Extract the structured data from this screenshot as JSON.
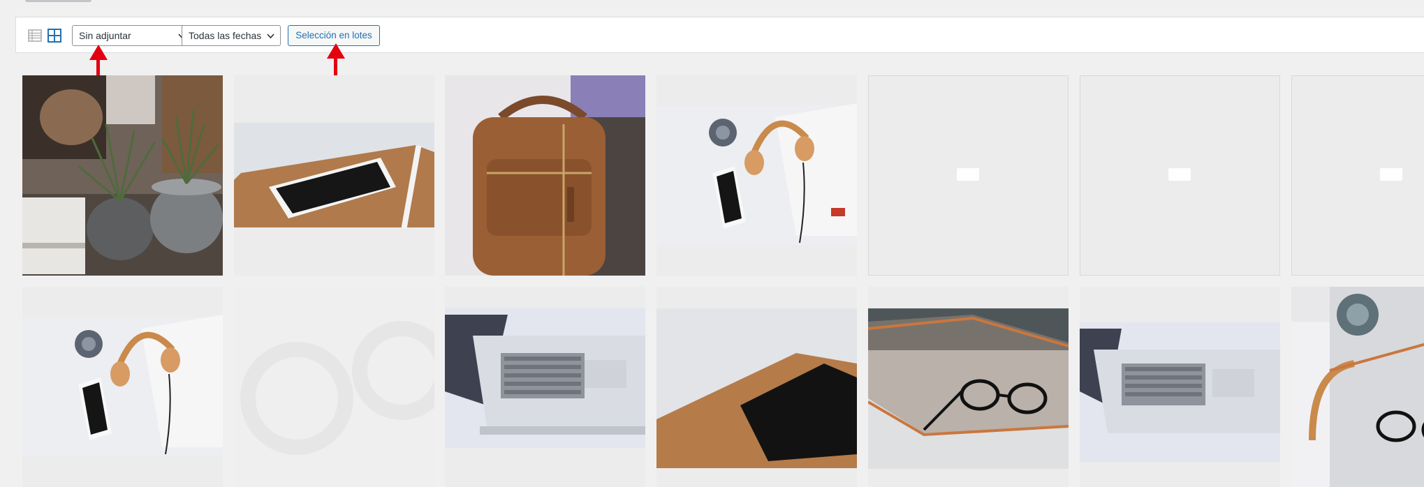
{
  "view": {
    "list_icon": "list-view-icon",
    "grid_icon": "grid-view-icon",
    "active": "grid"
  },
  "filters": {
    "attachment_filter": "Sin adjuntar",
    "date_filter": "Todas las fechas"
  },
  "toolbar": {
    "bulk_select_label": "Selección en lotes"
  },
  "annotations": {
    "arrow_color": "#e3000f",
    "arrow_count": 2
  },
  "colors": {
    "accent": "#2271b1",
    "background": "#f0f0f1",
    "toolbar_bg": "#ffffff"
  },
  "media_grid": {
    "rows": [
      [
        {
          "kind": "photo",
          "subject": "plants-in-pots"
        },
        {
          "kind": "photo",
          "subject": "smartphone-on-tablet-case"
        },
        {
          "kind": "photo",
          "subject": "brown-leather-backpack"
        },
        {
          "kind": "photo",
          "subject": "headphones-and-phone"
        },
        {
          "kind": "placeholder",
          "subject": "blank-thumbnail"
        },
        {
          "kind": "placeholder",
          "subject": "blank-thumbnail"
        },
        {
          "kind": "placeholder",
          "subject": "blank-thumbnail"
        }
      ],
      [
        {
          "kind": "photo",
          "subject": "headphones-and-phone"
        },
        {
          "kind": "placeholder",
          "subject": "blank-thumbnail"
        },
        {
          "kind": "photo",
          "subject": "laptop-keyboard"
        },
        {
          "kind": "photo",
          "subject": "tablet-on-leather-case"
        },
        {
          "kind": "photo",
          "subject": "glasses-on-copper-tray"
        },
        {
          "kind": "photo",
          "subject": "laptop-keyboard"
        },
        {
          "kind": "photo",
          "subject": "succulent-and-glasses"
        }
      ]
    ]
  }
}
